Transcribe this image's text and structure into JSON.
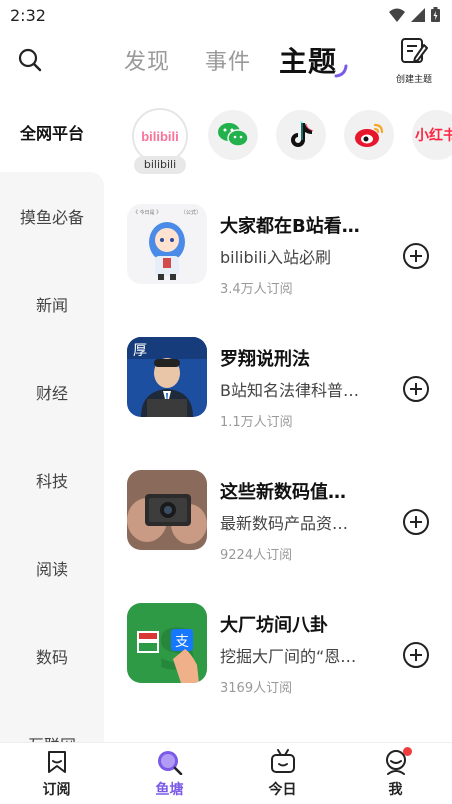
{
  "status_bar": {
    "time": "2:32"
  },
  "top_nav": {
    "tabs": [
      {
        "label": "发现"
      },
      {
        "label": "事件"
      },
      {
        "label": "主题"
      }
    ],
    "create_topic_label": "创建主题"
  },
  "left_top_label": "全网平台",
  "platforms": [
    {
      "name": "bilibili",
      "logo_text": "bilibili",
      "icon": "bilibili-logo"
    },
    {
      "name": "wechat",
      "icon": "wechat-icon"
    },
    {
      "name": "douyin",
      "icon": "tiktok-icon"
    },
    {
      "name": "weibo",
      "icon": "weibo-icon"
    },
    {
      "name": "xiaohongshu",
      "logo_text": "小红书",
      "icon": "xiaohongshu-logo"
    }
  ],
  "sidebar": {
    "items": [
      {
        "label": "摸鱼必备"
      },
      {
        "label": "新闻"
      },
      {
        "label": "财经"
      },
      {
        "label": "科技"
      },
      {
        "label": "阅读"
      },
      {
        "label": "数码"
      },
      {
        "label": "互联网"
      }
    ]
  },
  "topics": [
    {
      "title": "大家都在B站看…",
      "desc": "bilibili入站必刷",
      "subs": "3.4万人订阅"
    },
    {
      "title": "罗翔说刑法",
      "desc": "B站知名法律科普…",
      "subs": "1.1万人订阅"
    },
    {
      "title": "这些新数码值…",
      "desc": "最新数码产品资…",
      "subs": "9224人订阅"
    },
    {
      "title": "大厂坊间八卦",
      "desc": "挖掘大厂间的“恩…",
      "subs": "3169人订阅"
    }
  ],
  "bottom_nav": {
    "tabs": [
      {
        "label": "订阅"
      },
      {
        "label": "鱼塘"
      },
      {
        "label": "今日"
      },
      {
        "label": "我"
      }
    ]
  },
  "colors": {
    "accent": "#7b5ae8",
    "bilibili": "#fb7299",
    "wechat": "#22b14c",
    "weibo": "#e6162d",
    "xiaohongshu": "#ff2442"
  }
}
